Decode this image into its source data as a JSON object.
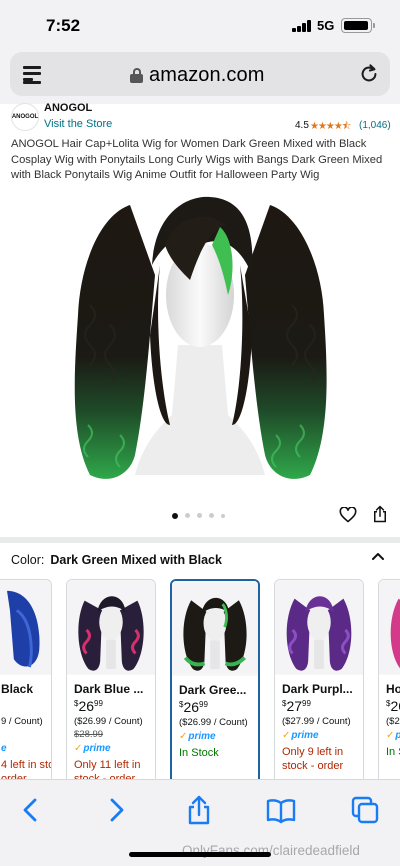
{
  "status_bar": {
    "time": "7:52",
    "network": "5G"
  },
  "browser": {
    "url": "amazon.com"
  },
  "product": {
    "brand": "ANOGOL",
    "brand_logo_text": "ANOGOL",
    "visit_store": "Visit the Store",
    "rating": "4.5",
    "rating_count": "(1,046)",
    "title": "ANOGOL Hair Cap+Lolita Wig for Women Dark Green Mixed with Black Cosplay Wig with Ponytails Long Curly Wigs with Bangs Dark Green Mixed with Black Ponytails Wig Anime Outfit for Halloween Party Wig",
    "image_count": 5,
    "active_image": 1
  },
  "color": {
    "label": "Color:",
    "value": "Dark Green Mixed with Black"
  },
  "variants": [
    {
      "name": "Black",
      "price_whole": "",
      "price_frac": "",
      "unit": "9 / Count)",
      "list_price": "",
      "prime": "e",
      "stock": "4 left in stock - order",
      "stock_type": "red",
      "selected": false
    },
    {
      "name": "Dark Blue ...",
      "price_whole": "26",
      "price_frac": "99",
      "unit": "($26.99 / Count)",
      "list_price": "$28.99",
      "prime": "prime",
      "stock": "Only 11 left in stock - order",
      "stock_type": "red",
      "selected": false
    },
    {
      "name": "Dark Gree...",
      "price_whole": "26",
      "price_frac": "99",
      "unit": "($26.99 / Count)",
      "list_price": "",
      "prime": "prime",
      "stock": "In Stock",
      "stock_type": "green",
      "selected": true
    },
    {
      "name": "Dark Purpl...",
      "price_whole": "27",
      "price_frac": "99",
      "unit": "($27.99 / Count)",
      "list_price": "",
      "prime": "prime",
      "stock": "Only 9 left in stock - order",
      "stock_type": "red",
      "selected": false
    },
    {
      "name": "Ho",
      "price_whole": "26",
      "price_frac": "",
      "unit": "($26",
      "list_price": "",
      "prime": "p",
      "stock": "In S",
      "stock_type": "green",
      "selected": false
    }
  ],
  "colors": {
    "link": "#007185",
    "star": "#de7921",
    "prime": "#1a98ff",
    "selected_border": "#2162a1",
    "toolbar_icon": "#1a7cf5"
  },
  "toolbar": {
    "icons": [
      "back-icon",
      "forward-icon",
      "share-icon",
      "bookmarks-icon",
      "tabs-icon"
    ]
  },
  "watermark": "OnlyFans.com/clairedeadfield"
}
